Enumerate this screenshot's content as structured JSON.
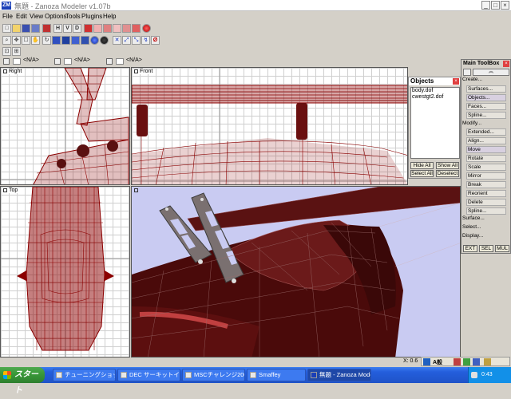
{
  "window": {
    "title": "無題 - Zanoza Modeler v1.07b",
    "app_icon": "ZM"
  },
  "menu": [
    "File",
    "Edit",
    "View",
    "Options",
    "Tools",
    "Plugins",
    "Help"
  ],
  "toolbar": {
    "row1": [
      "new-icon",
      "open-icon",
      "save-icon",
      "save-as-icon",
      "import-icon",
      "export-icon",
      "h-view",
      "v-view",
      "d-view",
      "cube-red-icon",
      "cube-outline-icon",
      "cube-stack-icon",
      "cube-wire-icon",
      "cube-box-icon",
      "sphere-red-icon"
    ],
    "row1_letters": {
      "h": "H",
      "v": "V",
      "d": "D"
    },
    "row2": [
      "zoom-icon",
      "pan-icon",
      "select-icon",
      "rotate-icon",
      "cube-solid-icon",
      "cylinder-icon",
      "drop-icon",
      "sphere-blue-icon",
      "sphere-dark-icon",
      "axis-icon",
      "axis-x-icon",
      "axis-y-icon",
      "axis-z-icon",
      "no-icon"
    ]
  },
  "view_slots": [
    {
      "label": "<N/A>"
    },
    {
      "label": "<N/A>"
    },
    {
      "label": "<N/A>"
    }
  ],
  "viewports": {
    "right": "Right",
    "front": "Front",
    "top": "Top",
    "perspective": ""
  },
  "objects_panel": {
    "title": "Objects",
    "items": [
      "body.dof",
      "cwestgt2.dof"
    ],
    "buttons": {
      "hide_all": "Hide All",
      "show_all": "Show All",
      "select_all": "Select All",
      "deselect": "Deselect"
    }
  },
  "toolbox": {
    "title": "Main ToolBox",
    "items": [
      {
        "label": "Create...",
        "level": "top"
      },
      {
        "label": "Surfaces...",
        "level": "sub"
      },
      {
        "label": "Objects...",
        "level": "sub",
        "selected": true
      },
      {
        "label": "Faces...",
        "level": "sub"
      },
      {
        "label": "Spline...",
        "level": "sub"
      },
      {
        "label": "Modify...",
        "level": "top"
      },
      {
        "label": "Extended...",
        "level": "sub"
      },
      {
        "label": "Align...",
        "level": "sub"
      },
      {
        "label": "Move",
        "level": "sub",
        "selected": true
      },
      {
        "label": "Rotate",
        "level": "sub"
      },
      {
        "label": "Scale",
        "level": "sub"
      },
      {
        "label": "Mirror",
        "level": "sub"
      },
      {
        "label": "Break",
        "level": "sub"
      },
      {
        "label": "Reorient",
        "level": "sub"
      },
      {
        "label": "Delete",
        "level": "sub"
      },
      {
        "label": "Spline...",
        "level": "sub"
      },
      {
        "label": "Surface...",
        "level": "top"
      },
      {
        "label": "Select...",
        "level": "top"
      },
      {
        "label": "Display...",
        "level": "top"
      }
    ],
    "footer": [
      "EXT",
      "SEL",
      "MUL"
    ]
  },
  "statusbar": {
    "coord": "X: 0.6",
    "ime": "A般"
  },
  "taskbar": {
    "start": "スタート",
    "tasks": [
      {
        "label": "チューニングショップ カロ..."
      },
      {
        "label": "DEC サーキットイベント..."
      },
      {
        "label": "MSCチャレンジ2007 [終..."
      },
      {
        "label": "Smaffey"
      },
      {
        "label": "無題 - Zanoza Model...",
        "active": true
      }
    ],
    "clock": "0:43"
  },
  "colors": {
    "mesh": "#8b0000",
    "viewport_bg": "#ffffff",
    "perspective_bg": "#c9cbf2",
    "taskbar": "#245edc",
    "start": "#3a9a3a"
  }
}
